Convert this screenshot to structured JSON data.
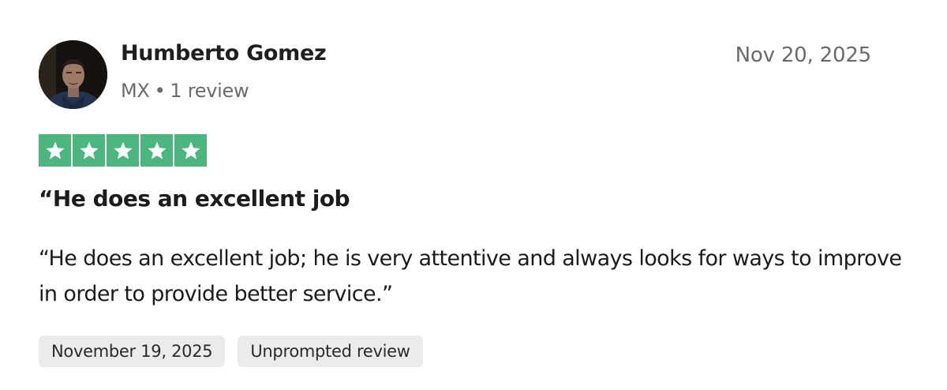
{
  "reviewer": {
    "name": "Humberto Gomez",
    "country": "MX",
    "separator": "•",
    "review_count": "1 review"
  },
  "review": {
    "date": "Nov 20, 2025",
    "rating": 5,
    "rating_max": 5,
    "star_color": "#4bb67e",
    "title": "“He does an excellent job",
    "body": "“He does an excellent job; he is very attentive and always looks for ways to improve in order to provide better service.”"
  },
  "tags": [
    {
      "label": "November 19, 2025"
    },
    {
      "label": "Unprompted review"
    }
  ]
}
